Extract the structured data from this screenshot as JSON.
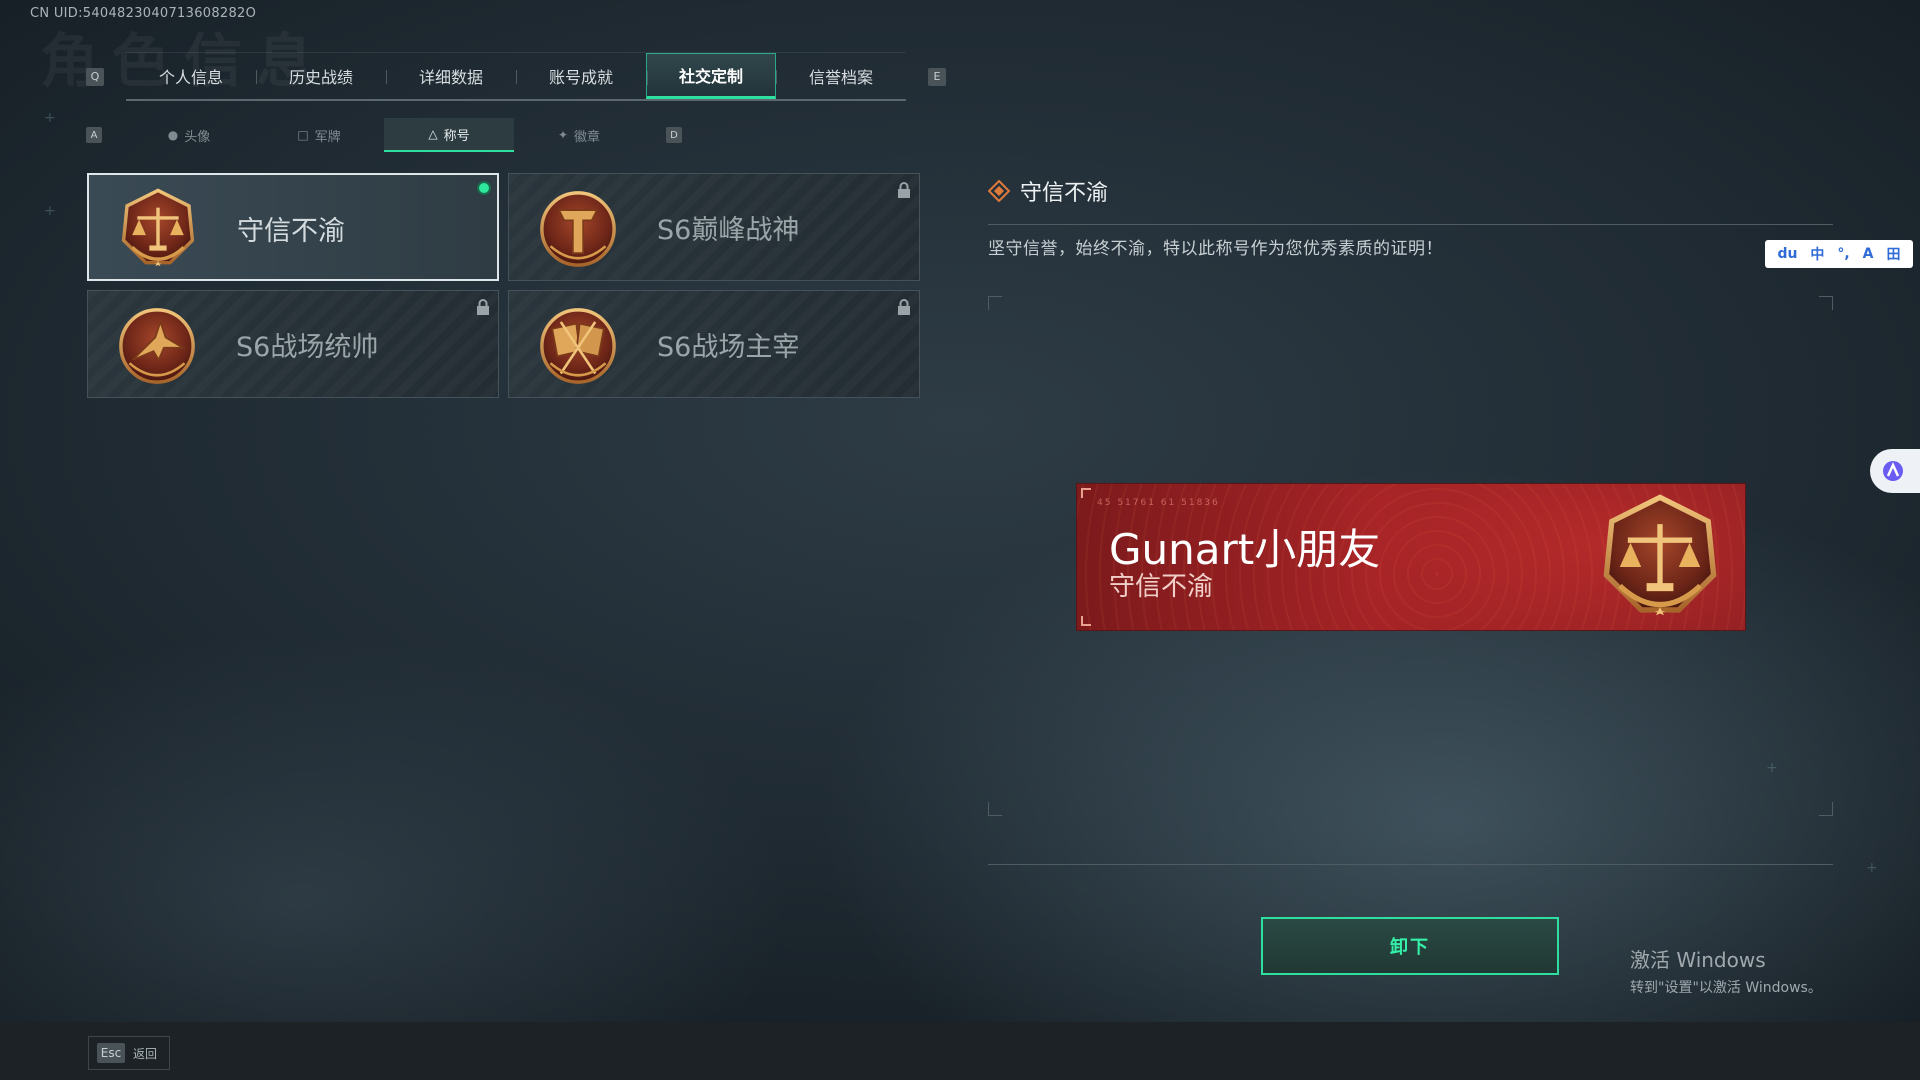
{
  "header": {
    "uid": "CN UID:5404823040713608282O",
    "ghost_title": "角色信息"
  },
  "main_tabs": {
    "left_key": "Q",
    "right_key": "E",
    "items": [
      {
        "label": "个人信息"
      },
      {
        "label": "历史战绩"
      },
      {
        "label": "详细数据"
      },
      {
        "label": "账号成就"
      },
      {
        "label": "社交定制",
        "active": true
      },
      {
        "label": "信誉档案"
      }
    ]
  },
  "sub_tabs": {
    "left_key": "A",
    "right_key": "D",
    "items": [
      {
        "label": "头像",
        "icon": "person-icon"
      },
      {
        "label": "军牌",
        "icon": "dogtag-icon"
      },
      {
        "label": "称号",
        "icon": "title-icon",
        "active": true
      },
      {
        "label": "徽章",
        "icon": "emblem-icon"
      }
    ]
  },
  "titles": [
    {
      "label": "守信不渝",
      "medal": "scales-medal",
      "state": "equipped"
    },
    {
      "label": "S6巅峰战神",
      "medal": "shield-t-medal",
      "state": "locked"
    },
    {
      "label": "S6战场统帅",
      "medal": "jet-medal",
      "state": "locked"
    },
    {
      "label": "S6战场主宰",
      "medal": "flags-medal",
      "state": "locked"
    }
  ],
  "detail": {
    "title": "守信不渝",
    "description": "坚守信誉，始终不渝，特以此称号作为您优秀素质的证明！"
  },
  "preview": {
    "code": "45 51761 61 51836",
    "player_name": "Gunart小朋友",
    "title": "守信不渝"
  },
  "actions": {
    "unequip_label": "卸下"
  },
  "watermark": {
    "line1": "激活 Windows",
    "line2": "转到\"设置\"以激活 Windows。"
  },
  "ime": {
    "items": [
      "du",
      "中",
      "°,",
      "A",
      "田"
    ]
  },
  "footer": {
    "esc_key": "Esc",
    "back_label": "返回"
  },
  "colors": {
    "accent": "#2ee0a0",
    "banner_red": "#a52326",
    "medal_gold": "#c98a3c"
  }
}
